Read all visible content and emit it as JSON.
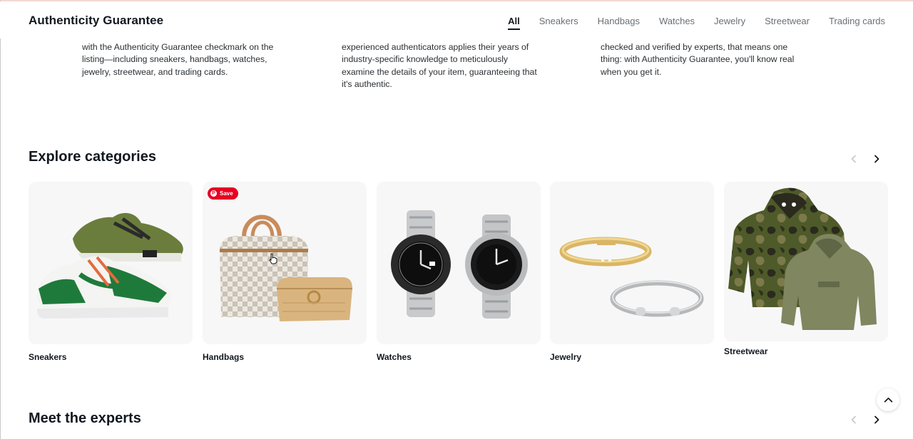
{
  "header": {
    "title": "Authenticity Guarantee",
    "tabs": [
      {
        "label": "All",
        "active": true
      },
      {
        "label": "Sneakers",
        "active": false
      },
      {
        "label": "Handbags",
        "active": false
      },
      {
        "label": "Watches",
        "active": false
      },
      {
        "label": "Jewelry",
        "active": false
      },
      {
        "label": "Streetwear",
        "active": false
      },
      {
        "label": "Trading cards",
        "active": false
      }
    ]
  },
  "info": {
    "col1": [
      "with the Authenticity Guarantee checkmark on the",
      "listing—including sneakers, handbags, watches,",
      "jewelry, streetwear, and trading cards."
    ],
    "col2": [
      "experienced authenticators applies their years of",
      "industry-specific knowledge to meticulously",
      "examine the details of your item, guaranteeing that",
      "it's authentic."
    ],
    "col3": [
      "checked and verified by experts, that means one",
      "thing: with Authenticity Guarantee, you'll know real",
      "when you get it."
    ]
  },
  "explore": {
    "title": "Explore categories",
    "categories": [
      {
        "label": "Sneakers",
        "image": "sneakers-image"
      },
      {
        "label": "Handbags",
        "image": "handbags-image",
        "save_label": "Save"
      },
      {
        "label": "Watches",
        "image": "watches-image"
      },
      {
        "label": "Jewelry",
        "image": "jewelry-image"
      },
      {
        "label": "Streetwear",
        "image": "streetwear-image"
      }
    ]
  },
  "experts": {
    "title": "Meet the experts"
  },
  "icons": {
    "prev": "chevron-left-icon",
    "next": "chevron-right-icon",
    "scroll_top": "chevron-up-icon"
  },
  "colors": {
    "text": "#111820",
    "muted": "#6a6f75",
    "card_bg": "#f7f7f7",
    "save_red": "#e60023"
  }
}
